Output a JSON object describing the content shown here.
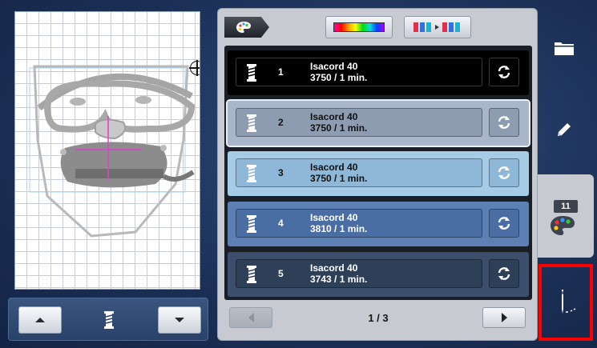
{
  "preview": {
    "icons": [
      "embroidery-design-goggles-face",
      "center-crosshair",
      "frame-reticle"
    ]
  },
  "move_bar": {
    "up_icon": "arrow-up-icon",
    "down_icon": "arrow-down-icon",
    "spool_icon": "thread-spool-icon"
  },
  "toolbar": {
    "palette_icon": "palette-icon",
    "rainbow_icon": "rainbow-color-bar-icon",
    "sort_icon": "thread-sort-icon"
  },
  "threads": [
    {
      "number": "1",
      "name": "Isacord 40",
      "code": "3750 / 1 min.",
      "color": "#000000"
    },
    {
      "number": "2",
      "name": "Isacord 40",
      "code": "3750 / 1 min.",
      "color": "#a9b6c9"
    },
    {
      "number": "3",
      "name": "Isacord 40",
      "code": "3750 / 1 min.",
      "color": "#a6cbe6"
    },
    {
      "number": "4",
      "name": "Isacord 40",
      "code": "3810 / 1 min.",
      "color": "#5d80b4"
    },
    {
      "number": "5",
      "name": "Isacord 40",
      "code": "3743 / 1 min.",
      "color": "#3b4e6b"
    }
  ],
  "pager": {
    "page_label": "1 / 3"
  },
  "sidebar": {
    "folder_icon": "folder-icon",
    "pencil_icon": "pencil-icon",
    "color_count": "11",
    "palette_icon": "palette-icon",
    "stitch_icon": "needle-stitch-icon"
  },
  "colors": {
    "accent_highlight": "#ff0000",
    "panel_bg": "#c7cbd1"
  }
}
